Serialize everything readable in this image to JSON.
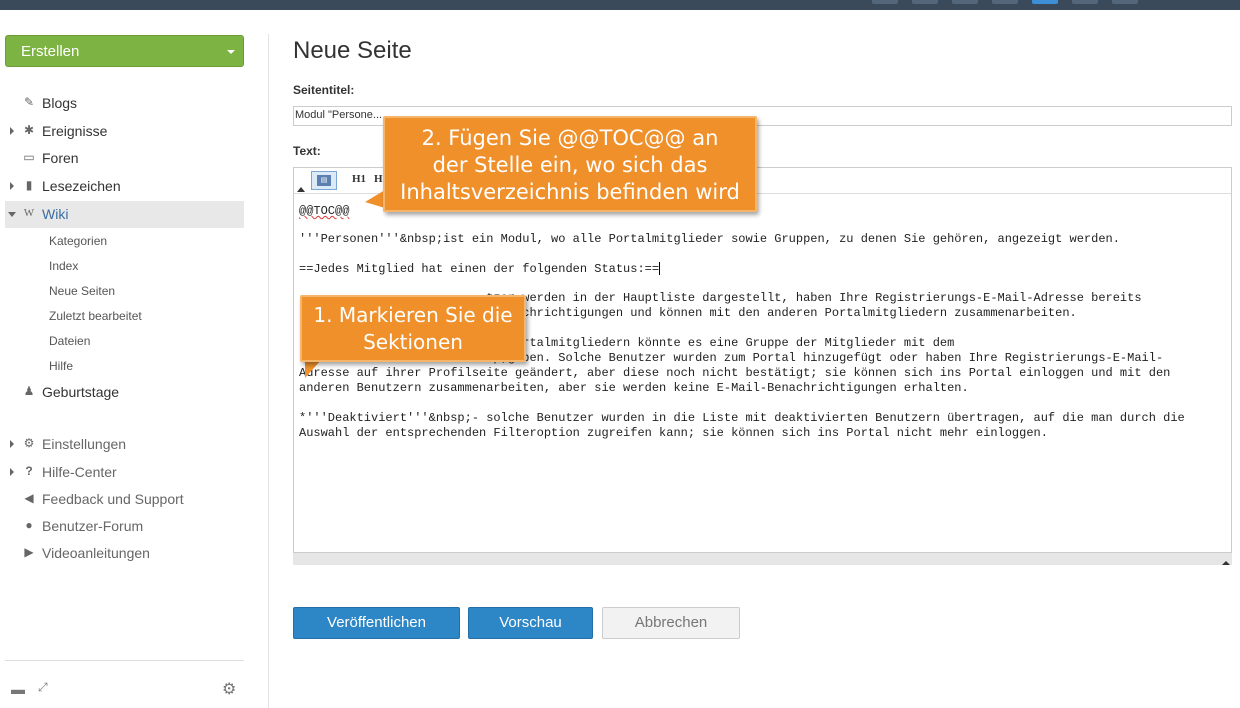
{
  "sidebar": {
    "create_label": "Erstellen",
    "items": [
      {
        "label": "Blogs",
        "icon": "edit-icon"
      },
      {
        "label": "Ereignisse",
        "icon": "pin-icon"
      },
      {
        "label": "Foren",
        "icon": "comment-icon"
      },
      {
        "label": "Lesezeichen",
        "icon": "bookmark-icon"
      },
      {
        "label": "Wiki",
        "icon": "wiki-icon"
      }
    ],
    "wiki_sub": [
      "Kategorien",
      "Index",
      "Neue Seiten",
      "Zuletzt bearbeitet",
      "Dateien",
      "Hilfe"
    ],
    "birthdays": "Geburtstage",
    "settings": "Einstellungen",
    "help_center": "Hilfe-Center",
    "feedback": "Feedback und Support",
    "user_forum": "Benutzer-Forum",
    "videos": "Videoanleitungen"
  },
  "main": {
    "title": "Neue Seite",
    "page_title_label": "Seitentitel:",
    "page_title_value": "Modul \"Persone...",
    "text_label": "Text:",
    "toolbar": {
      "h1": "H1",
      "h2": "H"
    },
    "content": {
      "line1": "@@TOC@@",
      "line2": "'''Personen'''&nbsp;ist ein Modul, wo alle Portalmitglieder sowie Gruppen, zu denen Sie gehören, angezeigt werden.",
      "line3": "==Jedes Mitglied hat einen der folgenden Status:==",
      "p1a": "                          tzer werden in der Hauptliste dargestellt, haben Ihre Registrierungs-E-Mail-Adresse bereits",
      "p1b": "                          -Benachrichtigungen und können mit den anderen Portalmitgliedern zusammenarbeiten.",
      "p2a": "                          sp;Portalmitgliedern könnte es eine Gruppe der Mitglieder mit dem",
      "p2b": "                          sp;geben. Solche Benutzer wurden zum Portal hinzugefügt oder haben Ihre Registrierungs-E-Mail-",
      "p2c": "Adresse auf ihrer Profilseite geändert, aber diese noch nicht bestätigt; sie können sich ins Portal einloggen und mit den",
      "p2d": "anderen Benutzern zusammenarbeiten, aber sie werden keine E-Mail-Benachrichtigungen erhalten.",
      "p3a": "*'''Deaktiviert'''&nbsp;- solche Benutzer wurden in die Liste mit deaktivierten Benutzern übertragen, auf die man durch die",
      "p3b": "Auswahl der entsprechenden Filteroption zugreifen kann; sie können sich ins Portal nicht mehr einloggen."
    },
    "buttons": {
      "publish": "Veröffentlichen",
      "preview": "Vorschau",
      "cancel": "Abbrechen"
    }
  },
  "callouts": {
    "c1_line1": "1. Markieren Sie die",
    "c1_line2": "Sektionen",
    "c2_line1": "2. Fügen Sie @@TOC@@ an",
    "c2_line2": "der Stelle ein, wo sich das",
    "c2_line3": "Inhaltsverzeichnis befinden wird"
  }
}
